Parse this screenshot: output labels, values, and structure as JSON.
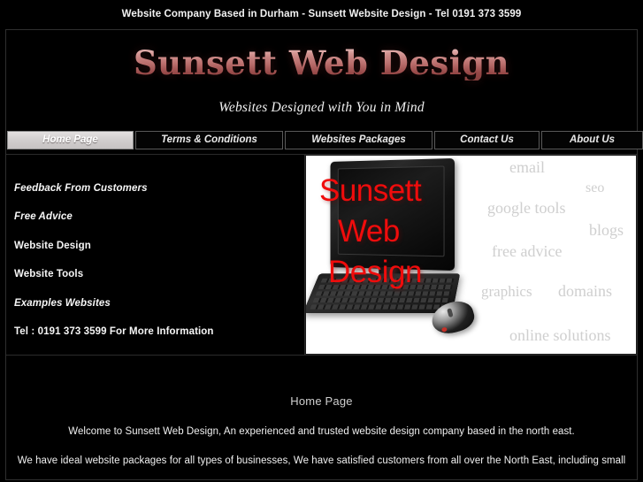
{
  "strapline": "Website Company Based in Durham - Sunsett Website Design - Tel 0191 373 3599",
  "masthead": {
    "logo": "Sunsett Web Design",
    "tagline": "Websites Designed with You in Mind",
    "logo_gradient_top": "#f6d9d7",
    "logo_gradient_bottom": "#8b4543"
  },
  "nav": {
    "tabs": [
      {
        "label": "Home Page",
        "active": true
      },
      {
        "label": "Terms & Conditions",
        "active": false
      },
      {
        "label": "Websites Packages",
        "active": false
      },
      {
        "label": "Contact Us",
        "active": false
      },
      {
        "label": "About Us",
        "active": false
      }
    ],
    "active_bg": "#d2cfcf"
  },
  "sidebar": {
    "items": [
      {
        "label": "Feedback From Customers",
        "italic": true
      },
      {
        "label": "Free Advice",
        "italic": true
      },
      {
        "label": "Website Design",
        "italic": false
      },
      {
        "label": "Website Tools",
        "italic": false
      },
      {
        "label": "Examples  Websites",
        "italic": true
      },
      {
        "label": "Tel : 0191 373 3599  For More Information",
        "italic": false
      }
    ]
  },
  "banner": {
    "overlay_color": "#f00c0c",
    "keyword_color": "#cfcfcf",
    "background": "#ffffff",
    "overlay_lines": [
      "Sunsett",
      "Web",
      "Design"
    ],
    "keywords": [
      "email",
      "seo",
      "google tools",
      "blogs",
      "free advice",
      "graphics",
      "domains",
      "online solutions"
    ]
  },
  "content": {
    "heading": "Home Page",
    "paragraphs": [
      "Welcome to Sunsett Web Design, An experienced and trusted website design company based in the north east.",
      "We have ideal website packages for all types of businesses, We have satisfied customers from all over the North East, including small"
    ]
  }
}
